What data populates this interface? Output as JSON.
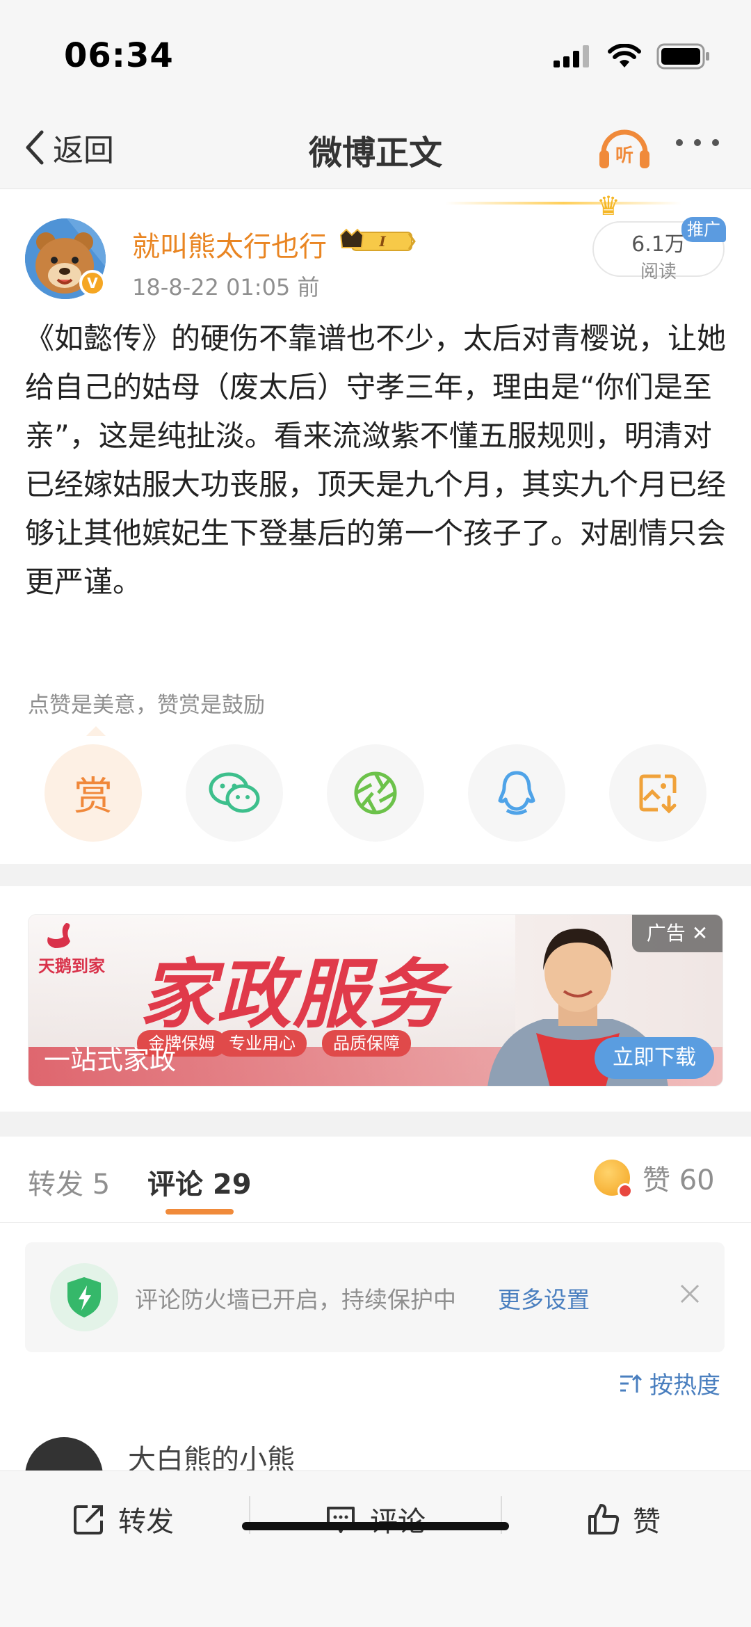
{
  "status_bar": {
    "time": "06:34"
  },
  "nav": {
    "back_label": "返回",
    "title": "微博正文",
    "listen_label": "听"
  },
  "post": {
    "username": "就叫熊太行也行",
    "user_level_badge": "I",
    "avatar_badge": "V",
    "meta": "18-8-22 01:05  前",
    "read_count": "6.1万",
    "read_label": "阅读",
    "promo_tag": "推广",
    "text": "《如懿传》的硬伤不靠谱也不少，太后对青樱说，让她给自己的姑母（废太后）守孝三年，理由是“你们是至亲”，这是纯扯淡。看来流潋紫不懂五服规则，明清对已经嫁姑服大功丧服，顶天是九个月，其实九个月已经够让其他嫔妃生下登基后的第一个孩子了。对剧情只会更严谨。",
    "reward_hint": "点赞是美意，赞赏是鼓励",
    "reward_button": "赏",
    "share_icons": [
      "reward-icon",
      "wechat-icon",
      "moments-icon",
      "qq-icon",
      "save-image-icon"
    ]
  },
  "ad": {
    "brand": "天鹅到家",
    "title": "家政服务",
    "pills": [
      "金牌保姆",
      "专业用心",
      "品质保障"
    ],
    "slogan": "一站式家政",
    "label": "广告",
    "download": "立即下载"
  },
  "tabs": {
    "repost": "转发 5",
    "comment": "评论 29",
    "like": "赞 60"
  },
  "firewall": {
    "text": "评论防火墙已开启，持续保护中",
    "link": "更多设置"
  },
  "sort": {
    "label": "按热度"
  },
  "comment_preview": {
    "author": "大白熊的小熊"
  },
  "bottom_bar": {
    "repost": "转发",
    "comment": "评论",
    "like": "赞"
  },
  "colors": {
    "accent_orange": "#e98522",
    "link_blue": "#4a7fbf",
    "ad_red": "#e03a4a"
  }
}
